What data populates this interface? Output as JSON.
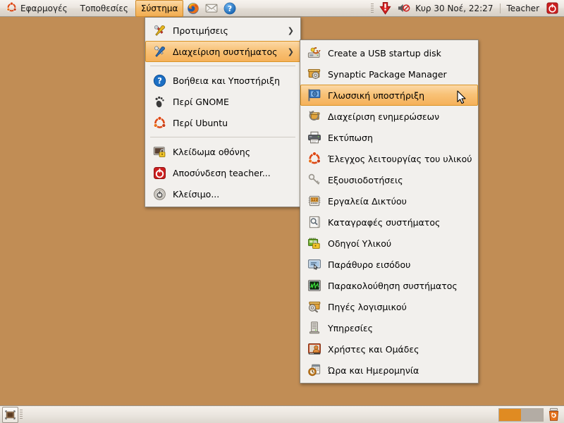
{
  "desktop": {
    "background_color": "#c18d55"
  },
  "top_panel": {
    "background_color": "#ece7e1",
    "menus": [
      {
        "label": "Εφαρμογές",
        "icon": "ubuntu-logo-icon",
        "active": false
      },
      {
        "label": "Τοποθεσίες",
        "icon": null,
        "active": false
      },
      {
        "label": "Σύστημα",
        "icon": null,
        "active": true
      }
    ],
    "launchers": [
      {
        "name": "firefox-launcher-icon",
        "tooltip": "Firefox"
      },
      {
        "name": "mail-launcher-icon",
        "tooltip": "Evolution Mail"
      },
      {
        "name": "help-launcher-icon",
        "tooltip": "Help"
      }
    ],
    "tray": [
      {
        "name": "update-manager-icon"
      },
      {
        "name": "volume-muted-icon"
      }
    ],
    "clock": "Κυρ 30 Νοέ, 22:27",
    "user_name": "Teacher",
    "shutdown_icon": "power-icon"
  },
  "system_menu": {
    "items": [
      {
        "label": "Προτιμήσεις",
        "icon": "preferences-icon",
        "submenu": true,
        "selected": false,
        "separator_after": false
      },
      {
        "label": "Διαχείριση συστήματος",
        "icon": "administration-icon",
        "submenu": true,
        "selected": true,
        "separator_after": true
      },
      {
        "label": "Βοήθεια και Υποστήριξη",
        "icon": "help-icon",
        "submenu": false,
        "selected": false,
        "separator_after": false
      },
      {
        "label": "Περί GNOME",
        "icon": "gnome-foot-icon",
        "submenu": false,
        "selected": false,
        "separator_after": false
      },
      {
        "label": "Περί Ubuntu",
        "icon": "ubuntu-logo-icon",
        "submenu": false,
        "selected": false,
        "separator_after": true
      },
      {
        "label": "Κλείδωμα οθόνης",
        "icon": "lock-screen-icon",
        "submenu": false,
        "selected": false,
        "separator_after": false
      },
      {
        "label": "Αποσύνδεση teacher...",
        "icon": "logout-icon",
        "submenu": false,
        "selected": false,
        "separator_after": false
      },
      {
        "label": "Κλείσιμο...",
        "icon": "shutdown-icon",
        "submenu": false,
        "selected": false,
        "separator_after": false
      }
    ]
  },
  "admin_submenu": {
    "items": [
      {
        "label": "Create a USB startup disk",
        "icon": "usb-startup-disk-icon",
        "selected": false
      },
      {
        "label": "Synaptic Package Manager",
        "icon": "synaptic-icon",
        "selected": false
      },
      {
        "label": "Γλωσσική υποστήριξη",
        "icon": "language-support-icon",
        "selected": true
      },
      {
        "label": "Διαχείριση ενημερώσεων",
        "icon": "update-manager-icon",
        "selected": false
      },
      {
        "label": "Εκτύπωση",
        "icon": "printer-icon",
        "selected": false
      },
      {
        "label": "Έλεγχος λειτουργίας του υλικού",
        "icon": "hardware-testing-icon",
        "selected": false
      },
      {
        "label": "Εξουσιοδοτήσεις",
        "icon": "authorizations-icon",
        "selected": false
      },
      {
        "label": "Εργαλεία Δικτύου",
        "icon": "network-tools-icon",
        "selected": false
      },
      {
        "label": "Καταγραφές συστήματος",
        "icon": "system-log-icon",
        "selected": false
      },
      {
        "label": "Οδηγοί Υλικού",
        "icon": "hardware-drivers-icon",
        "selected": false
      },
      {
        "label": "Παράθυρο εισόδου",
        "icon": "login-window-icon",
        "selected": false
      },
      {
        "label": "Παρακολούθηση συστήματος",
        "icon": "system-monitor-icon",
        "selected": false
      },
      {
        "label": "Πηγές λογισμικού",
        "icon": "software-sources-icon",
        "selected": false
      },
      {
        "label": "Υπηρεσίες",
        "icon": "services-icon",
        "selected": false
      },
      {
        "label": "Χρήστες και Ομάδες",
        "icon": "users-groups-icon",
        "selected": false
      },
      {
        "label": "Ώρα και Ημερομηνία",
        "icon": "time-date-icon",
        "selected": false
      }
    ]
  },
  "bottom_panel": {
    "show_desktop_icon": "show-desktop-icon",
    "window_list": [],
    "workspaces": [
      {
        "name": "workspace-1",
        "active": true
      },
      {
        "name": "workspace-2",
        "active": false
      }
    ],
    "trash_icon": "trash-icon"
  },
  "colors": {
    "desktop": "#c18d55",
    "panel": "#ece7e1",
    "menu_bg": "#f2f0ed",
    "highlight": "#f5b15a",
    "highlight_border": "#d99326",
    "accent_orange": "#e08b22"
  }
}
